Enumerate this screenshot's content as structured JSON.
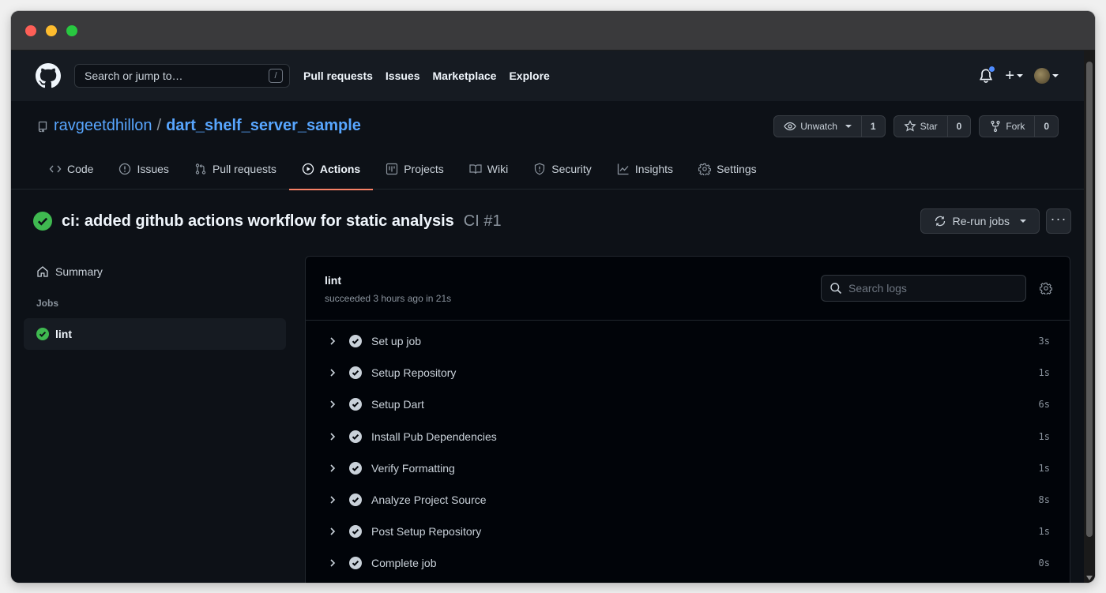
{
  "header": {
    "search_placeholder": "Search or jump to…",
    "search_shortcut": "/",
    "nav": [
      "Pull requests",
      "Issues",
      "Marketplace",
      "Explore"
    ]
  },
  "repo": {
    "owner": "ravgeetdhillon",
    "separator": "/",
    "name": "dart_shelf_server_sample",
    "unwatch_label": "Unwatch",
    "unwatch_count": "1",
    "star_label": "Star",
    "star_count": "0",
    "fork_label": "Fork",
    "fork_count": "0"
  },
  "tabs": [
    {
      "label": "Code",
      "icon": "code-icon"
    },
    {
      "label": "Issues",
      "icon": "issue-icon"
    },
    {
      "label": "Pull requests",
      "icon": "pull-request-icon"
    },
    {
      "label": "Actions",
      "icon": "play-icon",
      "active": true
    },
    {
      "label": "Projects",
      "icon": "project-icon"
    },
    {
      "label": "Wiki",
      "icon": "book-icon"
    },
    {
      "label": "Security",
      "icon": "shield-icon"
    },
    {
      "label": "Insights",
      "icon": "graph-icon"
    },
    {
      "label": "Settings",
      "icon": "gear-icon"
    }
  ],
  "run": {
    "title": "ci: added github actions workflow for static analysis",
    "workflow_number": "CI #1",
    "rerun_label": "Re-run jobs",
    "more_label": "···"
  },
  "sidebar": {
    "summary_label": "Summary",
    "jobs_heading": "Jobs",
    "jobs": [
      {
        "label": "lint"
      }
    ]
  },
  "job": {
    "name": "lint",
    "status": "succeeded 3 hours ago in 21s",
    "search_placeholder": "Search logs",
    "steps": [
      {
        "label": "Set up job",
        "duration": "3s"
      },
      {
        "label": "Setup Repository",
        "duration": "1s"
      },
      {
        "label": "Setup Dart",
        "duration": "6s"
      },
      {
        "label": "Install Pub Dependencies",
        "duration": "1s"
      },
      {
        "label": "Verify Formatting",
        "duration": "1s"
      },
      {
        "label": "Analyze Project Source",
        "duration": "8s"
      },
      {
        "label": "Post Setup Repository",
        "duration": "1s"
      },
      {
        "label": "Complete job",
        "duration": "0s"
      }
    ]
  },
  "colors": {
    "success": "#3fb950",
    "accent": "#58a6ff",
    "active_tab_underline": "#f78166",
    "background": "#0d1117"
  }
}
